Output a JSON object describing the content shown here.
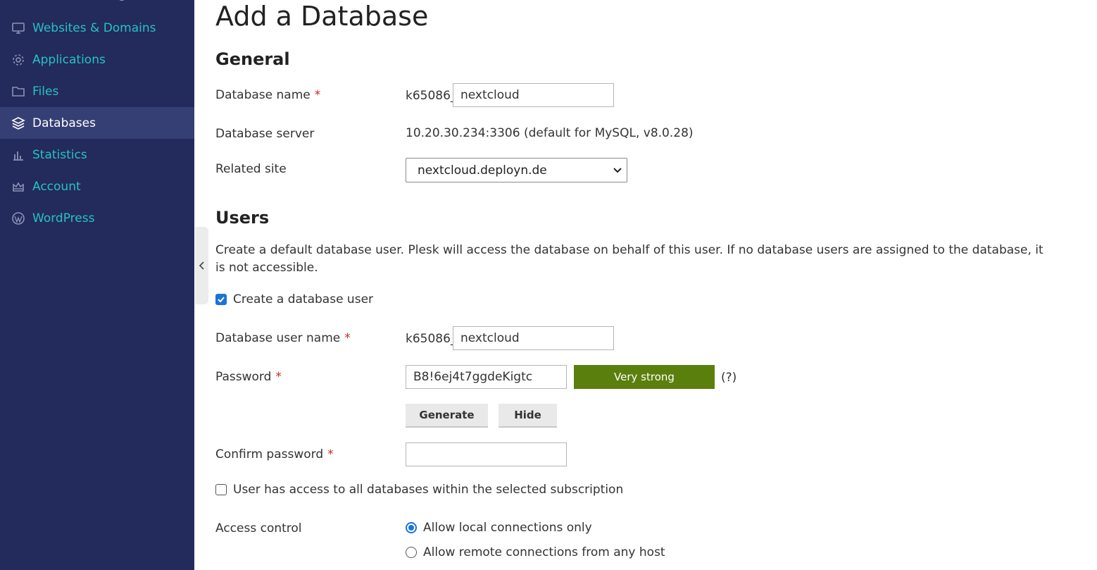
{
  "sidebar": {
    "items": [
      {
        "label": "Websites & Domains",
        "icon": "monitor-icon",
        "active": false
      },
      {
        "label": "Applications",
        "icon": "gear-icon",
        "active": false
      },
      {
        "label": "Files",
        "icon": "folder-icon",
        "active": false
      },
      {
        "label": "Databases",
        "icon": "layers-icon",
        "active": true
      },
      {
        "label": "Statistics",
        "icon": "bar-chart-icon",
        "active": false
      },
      {
        "label": "Account",
        "icon": "crown-icon",
        "active": false
      },
      {
        "label": "WordPress",
        "icon": "wordpress-icon",
        "active": false
      }
    ],
    "collapse_icon": "chevron-left-icon"
  },
  "page": {
    "title": "Add a Database"
  },
  "general": {
    "heading": "General",
    "db_name_label": "Database name",
    "db_name_prefix": "k65086_",
    "db_name_value": "nextcloud",
    "db_server_label": "Database server",
    "db_server_value": "10.20.30.234:3306 (default for MySQL, v8.0.28)",
    "related_site_label": "Related site",
    "related_site_value": "nextcloud.deployn.de"
  },
  "users": {
    "heading": "Users",
    "description": "Create a default database user. Plesk will access the database on behalf of this user. If no database users are assigned to the database, it is not accessible.",
    "create_user_label": "Create a database user",
    "create_user_checked": true,
    "user_name_label": "Database user name",
    "user_name_prefix": "k65086_",
    "user_name_value": "nextcloud",
    "password_label": "Password",
    "password_value": "B8!6ej4t7ggdeKigtc",
    "strength_label": "Very strong",
    "help_text": "(?)",
    "generate_label": "Generate",
    "hide_label": "Hide",
    "confirm_label": "Confirm password",
    "confirm_value": "",
    "all_access_label": "User has access to all databases within the selected subscription",
    "all_access_checked": false,
    "access_control_label": "Access control",
    "access_options": [
      {
        "label": "Allow local connections only",
        "selected": true
      },
      {
        "label": "Allow remote connections from any host",
        "selected": false
      }
    ]
  },
  "colors": {
    "sidebar_bg": "#232a5c",
    "sidebar_active_bg": "#363f73",
    "sidebar_link": "#27c2c6",
    "required_star": "#d02424",
    "strength_bar": "#5b7f0c",
    "accent": "#1a73d9"
  }
}
